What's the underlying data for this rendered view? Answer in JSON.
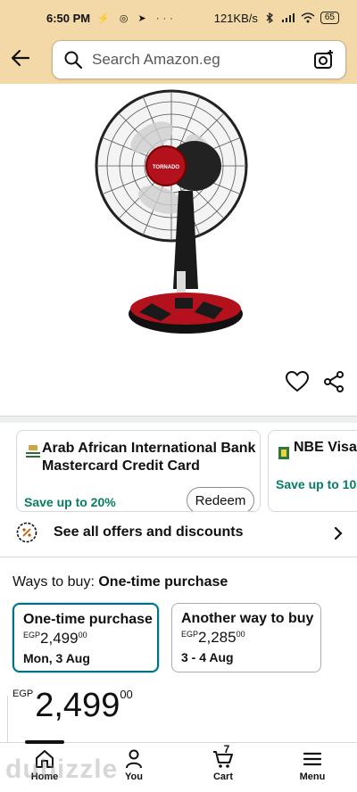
{
  "status_bar": {
    "time": "6:50 PM",
    "left_icons": "⚡ ◎ ➤ ···",
    "network_speed": "121KB/s",
    "battery": "65"
  },
  "header": {
    "back_icon": "back-arrow-icon",
    "search_placeholder": "Search Amazon.eg",
    "camera_icon": "camera-search-icon"
  },
  "product": {
    "brand_on_image": "TORNADO",
    "actions": [
      "wishlist-heart-icon",
      "share-icon"
    ]
  },
  "offers": [
    {
      "title": "Arab African International Bank Mastercard Credit Card",
      "savings": "Save up to 20%",
      "button": "Redeem"
    },
    {
      "title": "NBE Visa",
      "savings": "Save up to 10"
    }
  ],
  "all_offers": {
    "label": "See all offers and discounts"
  },
  "ways_to_buy": {
    "prefix": "Ways to buy:",
    "selected": "One-time purchase",
    "options": [
      {
        "title": "One-time purchase",
        "currency": "EGP",
        "price_whole": "2,499",
        "price_fraction": "00",
        "delivery": "Mon, 3 Aug",
        "selected": true
      },
      {
        "title": "Another way to buy",
        "currency": "EGP",
        "price_whole": "2,285",
        "price_fraction": "00",
        "delivery": "3 - 4 Aug",
        "selected": false
      }
    ]
  },
  "price": {
    "currency": "EGP",
    "whole": "2,499",
    "fraction": "00"
  },
  "bottom_nav": {
    "items": [
      {
        "label": "Home",
        "icon": "home-icon"
      },
      {
        "label": "You",
        "icon": "person-icon"
      },
      {
        "label": "Cart",
        "icon": "cart-icon"
      },
      {
        "label": "Menu",
        "icon": "menu-icon"
      }
    ],
    "cart_count": "7"
  },
  "watermark": "dubizzle",
  "colors": {
    "header_bg": "#f3d9a8",
    "savings_green": "#067d62",
    "selected_border": "#007185",
    "fan_red": "#b3121c"
  }
}
